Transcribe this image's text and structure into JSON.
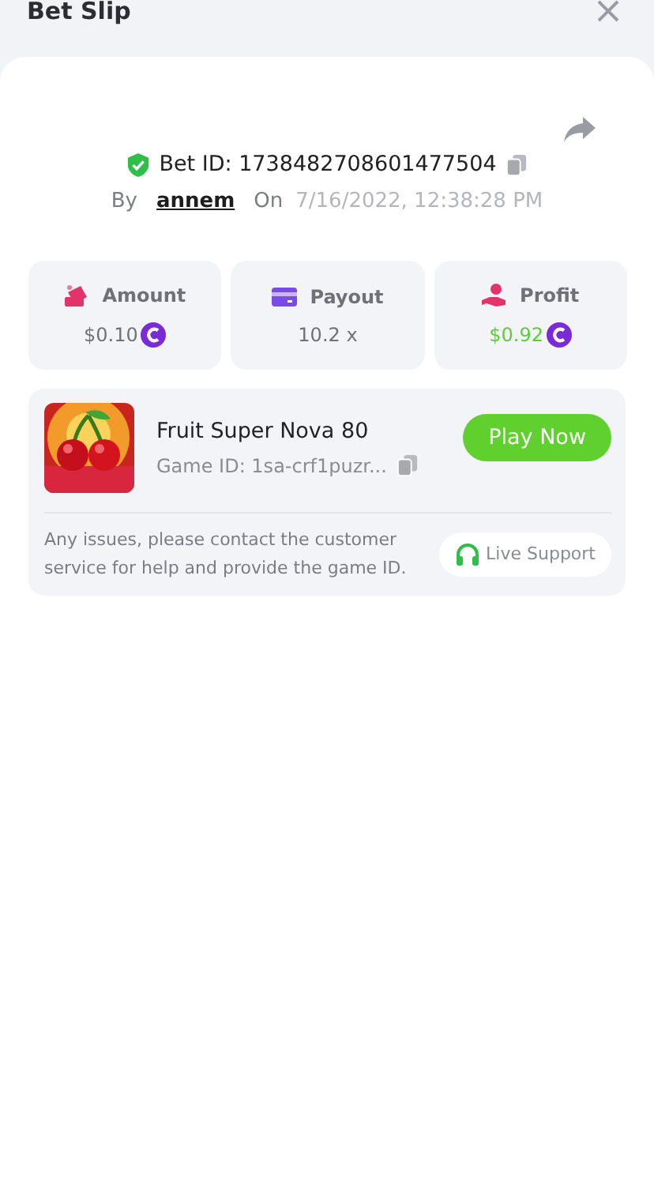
{
  "header": {
    "title": "Bet Slip"
  },
  "bet": {
    "id_label": "Bet ID: 1738482708601477504",
    "by_label": "By",
    "user": "annem",
    "on_label": "On",
    "date": "7/16/2022, 12:38:28 PM"
  },
  "stats": [
    {
      "kind": "amount",
      "label": "Amount",
      "value": "$0.10",
      "coin": true,
      "positive": false
    },
    {
      "kind": "payout",
      "label": "Payout",
      "value": "10.2 x",
      "coin": false,
      "positive": false
    },
    {
      "kind": "profit",
      "label": "Profit",
      "value": "$0.92",
      "coin": true,
      "positive": true
    }
  ],
  "game": {
    "name": "Fruit Super Nova 80",
    "game_id": "Game ID: 1sa-crf1puzr...",
    "play_button": "Play Now",
    "help_text": "Any issues, please contact the customer service for help and provide the game ID.",
    "support_button": "Live Support"
  }
}
